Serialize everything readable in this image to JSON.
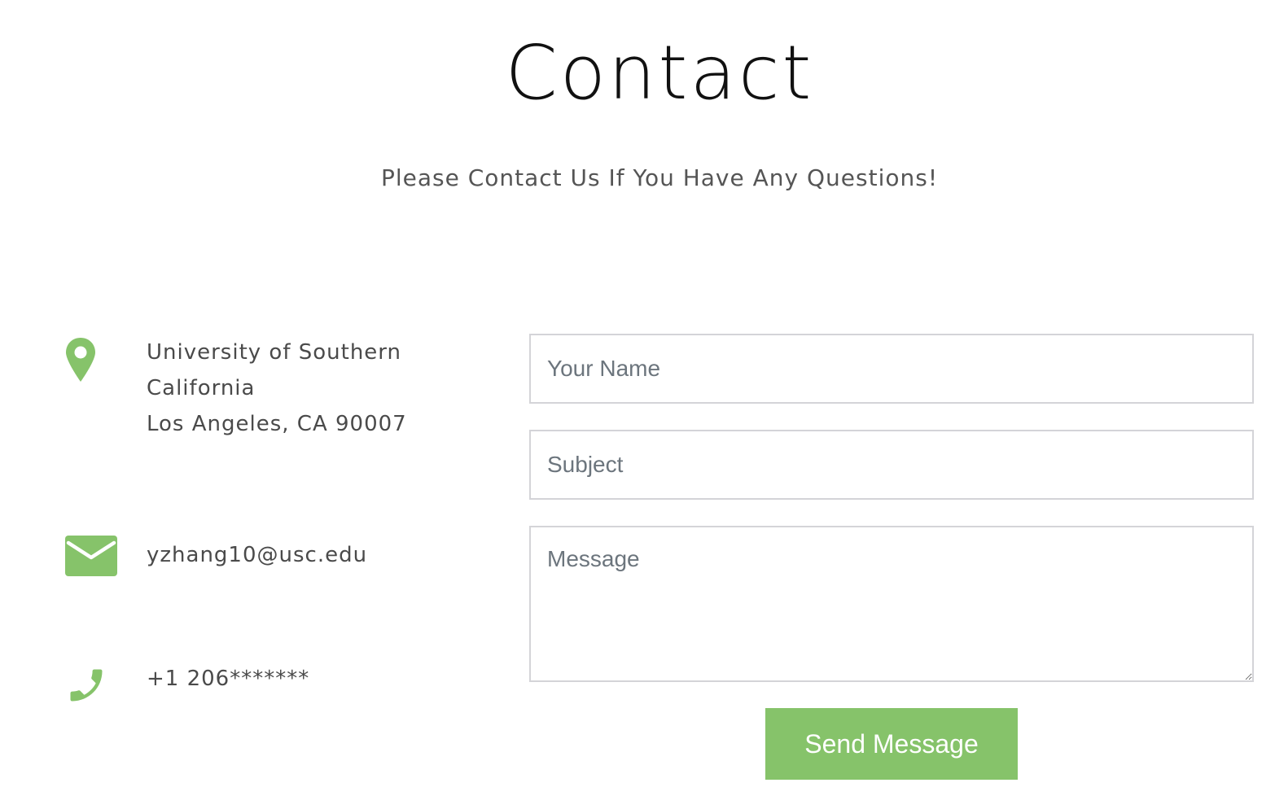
{
  "header": {
    "title": "Contact",
    "subtitle": "Please Contact Us If You Have Any Questions!"
  },
  "contact_info": {
    "address": {
      "icon": "map-pin-icon",
      "line1": "University of Southern",
      "line2": "California",
      "line3": "Los Angeles, CA 90007"
    },
    "email": {
      "icon": "envelope-icon",
      "text": "yzhang10@usc.edu"
    },
    "phone": {
      "icon": "phone-icon",
      "text": "+1 206*******"
    }
  },
  "form": {
    "name_placeholder": "Your Name",
    "name_value": "",
    "subject_placeholder": "Subject",
    "subject_value": "",
    "message_placeholder": "Message",
    "message_value": "",
    "submit_label": "Send Message"
  },
  "colors": {
    "accent": "#86c36a",
    "title": "#111111",
    "text": "#4a4a4a",
    "field_border": "#d4d4d8",
    "placeholder": "#6c757d"
  }
}
